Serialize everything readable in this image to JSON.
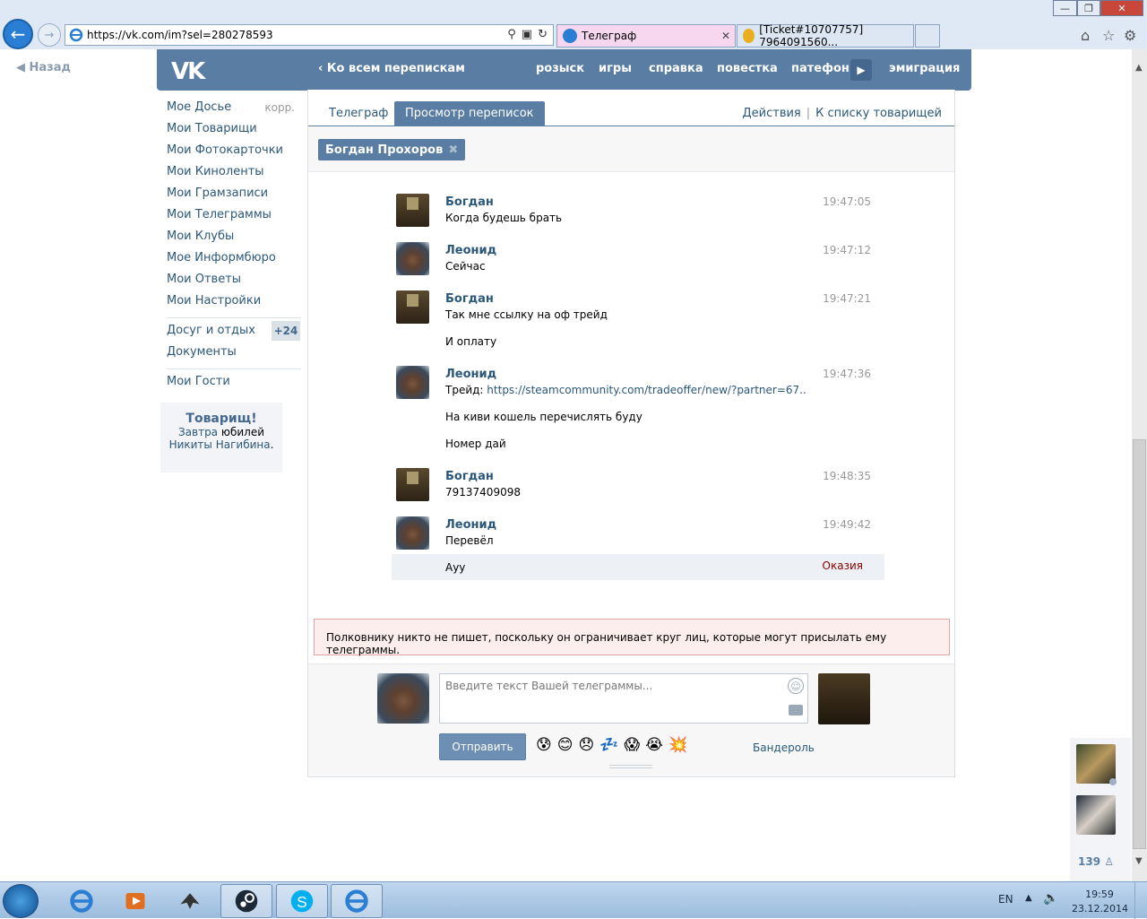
{
  "browser": {
    "url": "https://vk.com/im?sel=280278593",
    "tab1_title": "Телеграф",
    "tab2_title": "[Ticket#10707757] 7964091560...",
    "close_x": "✕",
    "min": "—",
    "max": "❐",
    "close": "✕"
  },
  "page": {
    "back_link": "Назад"
  },
  "header": {
    "logo": "VK",
    "all_convos": "Ко всем перепискам",
    "nav": [
      "розыск",
      "игры",
      "справка",
      "повестка",
      "патефон",
      "эмиграция"
    ]
  },
  "left_menu": {
    "items": [
      "Мое Досье",
      "Мои Товарищи",
      "Мои Фотокарточки",
      "Мои Киноленты",
      "Мои Грамзаписи",
      "Мои Телеграммы",
      "Мои Клубы",
      "Мое Информбюро",
      "Мои Ответы",
      "Мои Настройки"
    ],
    "edit_label": "корр.",
    "leisure": "Досуг и отдых",
    "leisure_badge": "+24",
    "documents": "Документы",
    "guests": "Мои Гости"
  },
  "birthday": {
    "title": "Товарищ!",
    "link1": "Завтра",
    "text1": "юбилей",
    "link2": "Никиты Нагибина",
    "dot": "."
  },
  "tabs": {
    "telegraph": "Телеграф",
    "view": "Просмотр переписок",
    "actions": "Действия",
    "pipe": "|",
    "to_list": "К списку товарищей"
  },
  "peer_chip": "Богдан Прохоров",
  "messages": [
    {
      "name": "Богдан",
      "time": "19:47:05",
      "lines": [
        "Когда будешь брать"
      ]
    },
    {
      "name": "Леонид",
      "time": "19:47:12",
      "lines": [
        "Сейчас"
      ]
    },
    {
      "name": "Богдан",
      "time": "19:47:21",
      "lines": [
        "Так мне ссылку на оф трейд",
        "И оплату"
      ]
    },
    {
      "name": "Леонид",
      "time": "19:47:36",
      "trade_prefix": "Трейд:",
      "trade_link": "https://steamcommunity.com/tradeoffer/new/?partner=67..",
      "lines": [
        "На киви кошель перечислять буду",
        "Номер дай"
      ]
    },
    {
      "name": "Богдан",
      "time": "19:48:35",
      "lines": [
        "79137409098"
      ]
    },
    {
      "name": "Леонид",
      "time": "19:49:42",
      "lines": [
        "Перевёл"
      ]
    }
  ],
  "unread": {
    "text": "Ауу",
    "error": "Оказия"
  },
  "warning": "Полковнику никто не пишет, поскольку он ограничивает круг лиц, которые могут присылать ему телеграммы.",
  "compose": {
    "placeholder": "Введите текст Вашей телеграммы...",
    "send": "Отправить",
    "parcel": "Бандероль",
    "emojis": [
      "😰",
      "😊",
      "😞",
      "💤",
      "😱",
      "😭",
      "💥"
    ]
  },
  "side": {
    "count": "139"
  },
  "taskbar": {
    "lang": "EN",
    "time": "19:59",
    "date": "23.12.2014"
  }
}
